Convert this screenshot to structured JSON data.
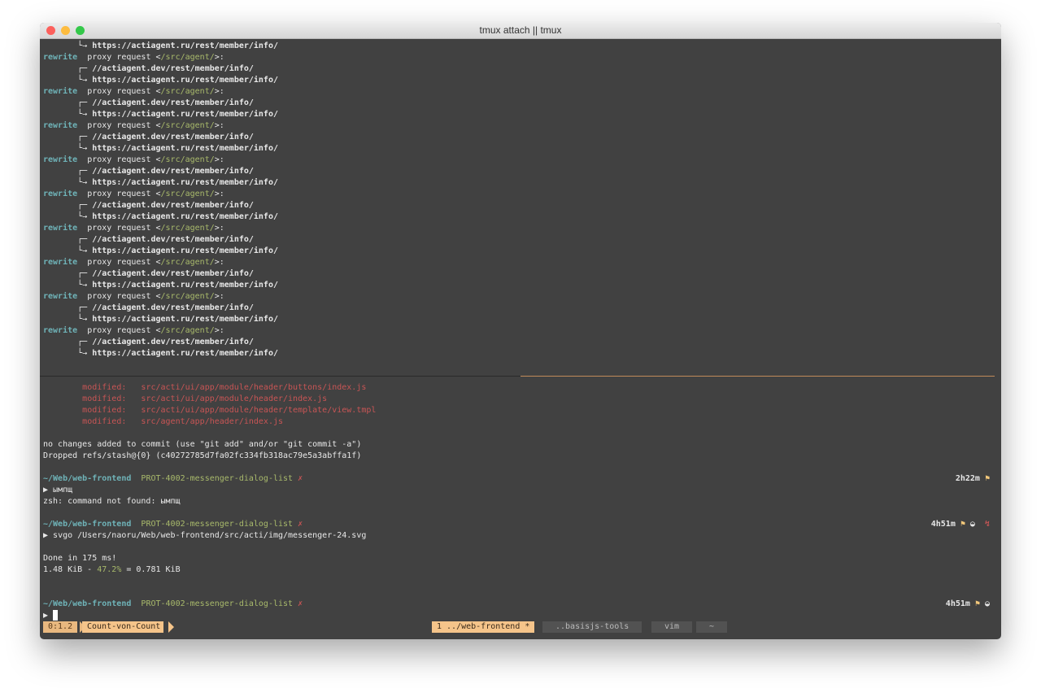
{
  "window": {
    "title": "tmux attach || tmux"
  },
  "top_pane": {
    "first_line": "https://actiagent.ru/rest/member/info/",
    "blocks": [
      {
        "tag": "rewrite",
        "text": "proxy request <",
        "path": "/src/agent/",
        "end": ">:",
        "from": "//actiagent.dev/rest/member/info/",
        "to": "https://actiagent.ru/rest/member/info/"
      },
      {
        "tag": "rewrite",
        "text": "proxy request <",
        "path": "/src/agent/",
        "end": ">:",
        "from": "//actiagent.dev/rest/member/info/",
        "to": "https://actiagent.ru/rest/member/info/"
      },
      {
        "tag": "rewrite",
        "text": "proxy request <",
        "path": "/src/agent/",
        "end": ">:",
        "from": "//actiagent.dev/rest/member/info/",
        "to": "https://actiagent.ru/rest/member/info/"
      },
      {
        "tag": "rewrite",
        "text": "proxy request <",
        "path": "/src/agent/",
        "end": ">:",
        "from": "//actiagent.dev/rest/member/info/",
        "to": "https://actiagent.ru/rest/member/info/"
      },
      {
        "tag": "rewrite",
        "text": "proxy request <",
        "path": "/src/agent/",
        "end": ">:",
        "from": "//actiagent.dev/rest/member/info/",
        "to": "https://actiagent.ru/rest/member/info/"
      },
      {
        "tag": "rewrite",
        "text": "proxy request <",
        "path": "/src/agent/",
        "end": ">:",
        "from": "//actiagent.dev/rest/member/info/",
        "to": "https://actiagent.ru/rest/member/info/"
      },
      {
        "tag": "rewrite",
        "text": "proxy request <",
        "path": "/src/agent/",
        "end": ">:",
        "from": "//actiagent.dev/rest/member/info/",
        "to": "https://actiagent.ru/rest/member/info/"
      },
      {
        "tag": "rewrite",
        "text": "proxy request <",
        "path": "/src/agent/",
        "end": ">:",
        "from": "//actiagent.dev/rest/member/info/",
        "to": "https://actiagent.ru/rest/member/info/"
      },
      {
        "tag": "rewrite",
        "text": "proxy request <",
        "path": "/src/agent/",
        "end": ">:",
        "from": "//actiagent.dev/rest/member/info/",
        "to": "https://actiagent.ru/rest/member/info/"
      }
    ]
  },
  "bottom_pane": {
    "modified": [
      {
        "label": "modified:",
        "file": "src/acti/ui/app/module/header/buttons/index.js"
      },
      {
        "label": "modified:",
        "file": "src/acti/ui/app/module/header/index.js"
      },
      {
        "label": "modified:",
        "file": "src/acti/ui/app/module/header/template/view.tmpl"
      },
      {
        "label": "modified:",
        "file": "src/agent/app/header/index.js"
      }
    ],
    "no_changes": "no changes added to commit (use \"git add\" and/or \"git commit -a\")",
    "dropped": "Dropped refs/stash@{0} (c40272785d7fa02fc334fb318ac79e5a3abffa1f)",
    "prompts": [
      {
        "cwd": "~/Web/web-frontend",
        "branch": "PROT-4002-messenger-dialog-list",
        "dirty": "✗",
        "time": "2h22m",
        "cmd": "ымпщ",
        "output": [
          "zsh: command not found: ымпщ"
        ]
      },
      {
        "cwd": "~/Web/web-frontend",
        "branch": "PROT-4002-messenger-dialog-list",
        "dirty": "✗",
        "time": "4h51m",
        "cmd": "svgo /Users/naoru/Web/web-frontend/src/acti/img/messenger-24.svg",
        "output": [
          "",
          "Done in 175 ms!"
        ]
      }
    ],
    "svgo_result": {
      "before": "1.48 KiB - ",
      "percent": "47.2%",
      "after": " = 0.781 KiB"
    },
    "last_prompt": {
      "cwd": "~/Web/web-frontend",
      "branch": "PROT-4002-messenger-dialog-list",
      "dirty": "✗",
      "time": "4h51m"
    }
  },
  "status_bar": {
    "session": "0:1.2",
    "host": "Count-von-Count",
    "windows": [
      {
        "label": "1 ../web-frontend *",
        "active": true
      },
      {
        "label": "..basisjs-tools",
        "active": false
      },
      {
        "label": "vim",
        "active": false
      },
      {
        "label": "~",
        "active": false
      }
    ]
  },
  "colors": {
    "bg": "#414141",
    "accent": "#f5c48a",
    "cyan": "#6fb3b8",
    "green": "#a8b96b",
    "red": "#c85555"
  }
}
